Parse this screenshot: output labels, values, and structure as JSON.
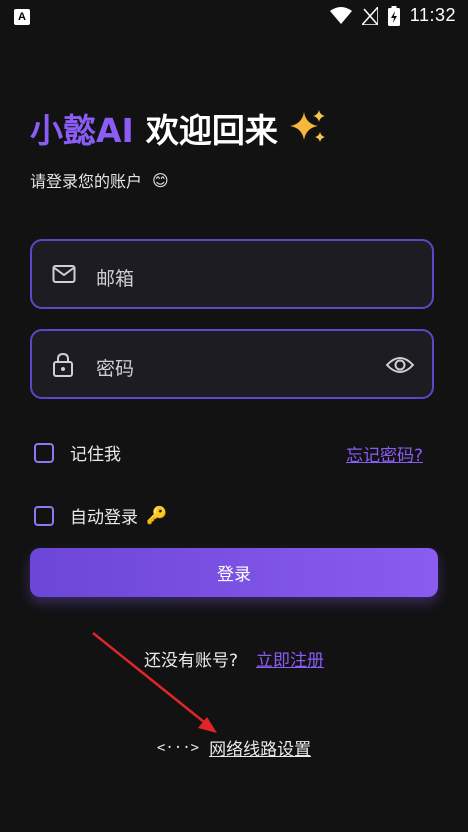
{
  "status_bar": {
    "time": "11:32",
    "app_icon_letter": "A"
  },
  "header": {
    "brand": "小懿AI",
    "welcome": "欢迎回来",
    "sparkle_icon": "sparkles"
  },
  "subtitle": {
    "text": "请登录您的账户",
    "emoji": "😊"
  },
  "form": {
    "email": {
      "placeholder": "邮箱",
      "icon": "mail-icon"
    },
    "password": {
      "placeholder": "密码",
      "icon": "lock-icon",
      "toggle_icon": "eye-icon"
    },
    "remember_me": {
      "label": "记住我",
      "checked": false
    },
    "forgot_password": "忘记密码?",
    "auto_login": {
      "label": "自动登录",
      "emoji": "🔑",
      "checked": false
    },
    "login_button": "登录"
  },
  "footer": {
    "no_account": "还没有账号?",
    "register_link": "立即注册",
    "network_icon": "<···>",
    "network_settings": "网络线路设置"
  },
  "colors": {
    "accent": "#8b5cf6",
    "background": "#121212",
    "field_border": "#5b48c8",
    "annotation_arrow": "#e0262b"
  }
}
